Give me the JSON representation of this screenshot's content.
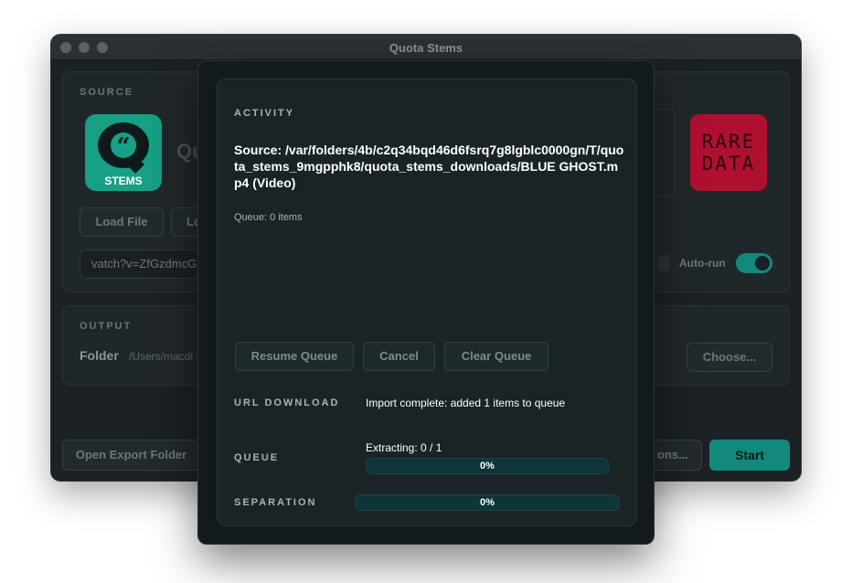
{
  "window": {
    "title": "Quota Stems"
  },
  "source": {
    "label": "SOURCE",
    "logo_text": "STEMS",
    "app_name_partial": "Qu",
    "load_file_label": "Load File",
    "load_second_partial": "Lo",
    "url_value": "vatch?v=ZfGzdmcG",
    "rare_logo_text": "RARE DATA",
    "autorun_label": "Auto-run",
    "autorun_on": true
  },
  "output": {
    "label": "OUTPUT",
    "folder_label": "Folder",
    "folder_path": "/Users/macdi",
    "choose_label": "Choose..."
  },
  "footer": {
    "open_export_label": "Open Export Folder",
    "options_partial": "ons...",
    "start_label": "Start"
  },
  "activity": {
    "label": "ACTIVITY",
    "source_line": "Source: /var/folders/4b/c2q34bqd46d6fsrq7g8lgblc0000gn/T/quota_stems_9mgpphk8/quota_stems_downloads/BLUE GHOST.mp4 (Video)",
    "queue_count": "Queue: 0 items",
    "resume_label": "Resume Queue",
    "cancel_label": "Cancel",
    "clear_label": "Clear Queue",
    "url_download_label": "URL DOWNLOAD",
    "url_download_status": "Import complete: added 1 items to queue",
    "queue_label": "QUEUE",
    "queue_status": "Extracting: 0 / 1",
    "queue_progress": 0,
    "queue_progress_text": "0%",
    "separation_label": "SEPARATION",
    "separation_progress": 0,
    "separation_progress_text": "0%"
  },
  "colors": {
    "accent": "#12897a",
    "background": "#1b2124",
    "sheet": "#131a1d"
  }
}
